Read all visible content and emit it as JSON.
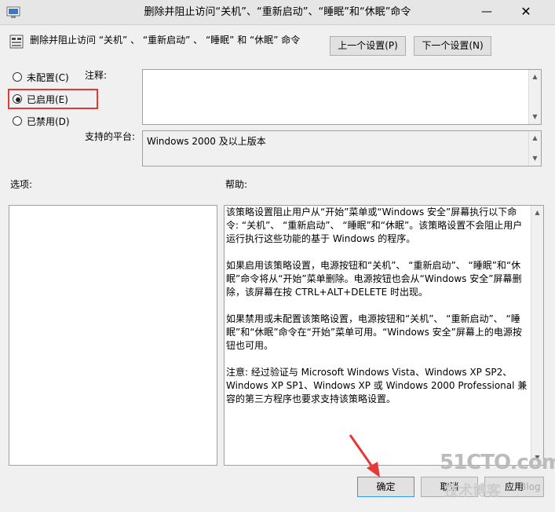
{
  "window": {
    "title": "删除并阻止访问“关机”、“重新启动”、“睡眠”和“休眠”命令",
    "minimize_glyph": "—",
    "close_glyph": "✕"
  },
  "header": {
    "policy_name": "删除并阻止访问 “关机” 、 “重新启动” 、 “睡眠” 和 “休眠” 命令",
    "prev_button": "上一个设置(P)",
    "next_button": "下一个设置(N)"
  },
  "radios": {
    "not_configured": "未配置(C)",
    "enabled": "已启用(E)",
    "disabled": "已禁用(D)",
    "selected": "enabled"
  },
  "comment": {
    "label": "注释:",
    "value": ""
  },
  "platform": {
    "label": "支持的平台:",
    "value": "Windows 2000 及以上版本"
  },
  "options": {
    "label": "选项:"
  },
  "help": {
    "label": "帮助:",
    "paragraphs": [
      "该策略设置阻止用户从“开始”菜单或“Windows 安全”屏幕执行以下命令: “关机”、 “重新启动”、 “睡眠”和“休眠”。该策略设置不会阻止用户运行执行这些功能的基于 Windows 的程序。",
      "如果启用该策略设置，电源按钮和“关机”、 “重新启动”、 “睡眠”和“休眠”命令将从“开始”菜单删除。电源按钮也会从“Windows 安全”屏幕删除，该屏幕在按 CTRL+ALT+DELETE 时出现。",
      "如果禁用或未配置该策略设置，电源按钮和“关机”、 “重新启动”、 “睡眠”和“休眠”命令在“开始”菜单可用。“Windows 安全”屏幕上的电源按钮也可用。",
      "注意: 经过验证与 Microsoft Windows Vista、Windows XP SP2、Windows XP SP1、Windows XP 或 Windows 2000 Professional 兼容的第三方程序也要求支持该策略设置。"
    ]
  },
  "footer": {
    "ok_button": "确定",
    "cancel_button": "取消",
    "apply_button": "应用"
  },
  "watermark": {
    "site": "51CTO.com",
    "tagline": "技术博客",
    "suffix": "Blog"
  },
  "colors": {
    "highlight": "#e53935",
    "arrow": "#e53935",
    "focus_button_border": "#3399ff"
  }
}
